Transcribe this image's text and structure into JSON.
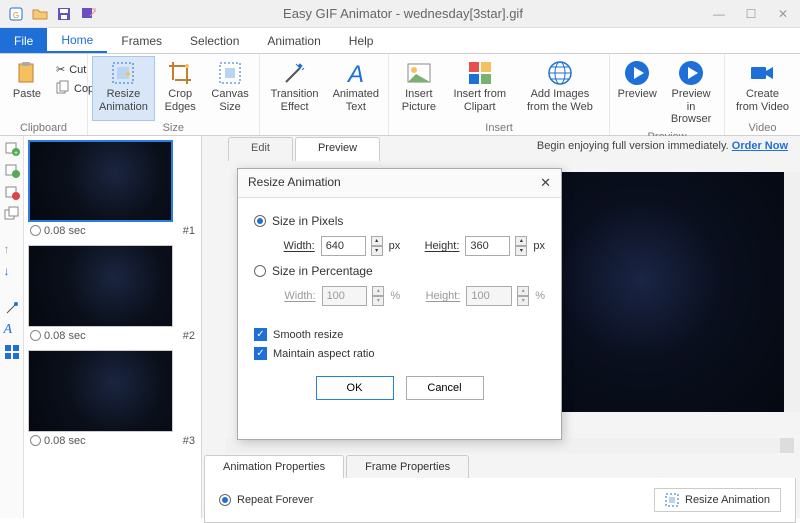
{
  "title": "Easy GIF Animator - wednesday[3star].gif",
  "menu": {
    "file": "File",
    "tabs": [
      "Home",
      "Frames",
      "Selection",
      "Animation",
      "Help"
    ]
  },
  "ribbon": {
    "clipboard": {
      "label": "Clipboard",
      "paste": "Paste",
      "cut": "Cut",
      "copy": "Copy"
    },
    "size": {
      "label": "Size",
      "resize": "Resize Animation",
      "crop": "Crop Edges",
      "canvas": "Canvas Size"
    },
    "transition": "Transition Effect",
    "atext": "Animated Text",
    "insert": {
      "label": "Insert",
      "picture": "Insert Picture",
      "clipart": "Insert from Clipart",
      "web": "Add Images from the Web"
    },
    "preview": {
      "label": "Preview",
      "preview": "Preview",
      "browser": "Preview in Browser"
    },
    "video": {
      "label": "Video",
      "create": "Create from Video"
    }
  },
  "frames": [
    {
      "time": "0.08 sec",
      "idx": "#1"
    },
    {
      "time": "0.08 sec",
      "idx": "#2"
    },
    {
      "time": "0.08 sec",
      "idx": "#3"
    }
  ],
  "subtabs": {
    "edit": "Edit",
    "preview": "Preview"
  },
  "promo": {
    "text": "Begin enjoying full version immediately. ",
    "link": "Order Now"
  },
  "dialog": {
    "title": "Resize Animation",
    "pixels": "Size in Pixels",
    "percent": "Size in Percentage",
    "width": "Width:",
    "height": "Height:",
    "px": "px",
    "pct": "%",
    "wval": "640",
    "hval": "360",
    "wpct": "100",
    "hpct": "100",
    "smooth": "Smooth resize",
    "aspect": "Maintain aspect ratio",
    "ok": "OK",
    "cancel": "Cancel"
  },
  "bottom": {
    "tab1": "Animation Properties",
    "tab2": "Frame Properties",
    "repeat": "Repeat Forever",
    "resize_btn": "Resize Animation"
  }
}
